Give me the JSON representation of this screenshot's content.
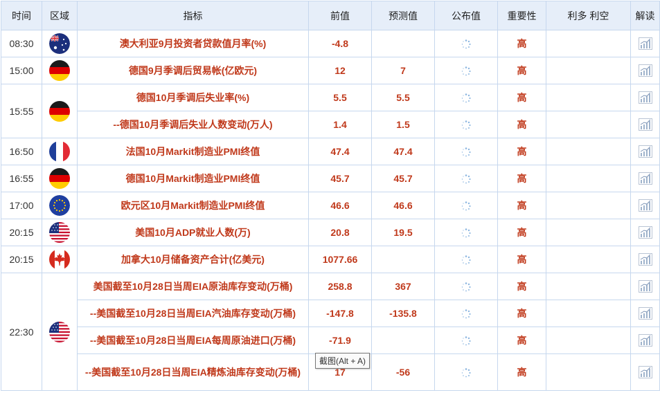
{
  "headers": {
    "time": "时间",
    "region": "区域",
    "indicator": "指标",
    "previous": "前值",
    "forecast": "预测值",
    "actual": "公布值",
    "importance": "重要性",
    "impact": "利多 利空",
    "analysis": "解读"
  },
  "rows": [
    {
      "time": "08:30",
      "flag": "australia",
      "indicator": "澳大利亚9月投资者贷款值月率(%)",
      "previous": "-4.8",
      "forecast": "",
      "importance": "高"
    },
    {
      "time": "15:00",
      "flag": "germany",
      "indicator": "德国9月季调后贸易帐(亿欧元)",
      "previous": "12",
      "forecast": "7",
      "importance": "高"
    },
    {
      "time": "15:55",
      "flag": "germany",
      "indicator": "德国10月季调后失业率(%)",
      "previous": "5.5",
      "forecast": "5.5",
      "importance": "高"
    },
    {
      "time": "",
      "flag": "",
      "indicator": "--德国10月季调后失业人数变动(万人)",
      "previous": "1.4",
      "forecast": "1.5",
      "importance": "高"
    },
    {
      "time": "16:50",
      "flag": "france",
      "indicator": "法国10月Markit制造业PMI终值",
      "previous": "47.4",
      "forecast": "47.4",
      "importance": "高"
    },
    {
      "time": "16:55",
      "flag": "germany",
      "indicator": "德国10月Markit制造业PMI终值",
      "previous": "45.7",
      "forecast": "45.7",
      "importance": "高"
    },
    {
      "time": "17:00",
      "flag": "eu",
      "indicator": "欧元区10月Markit制造业PMI终值",
      "previous": "46.6",
      "forecast": "46.6",
      "importance": "高"
    },
    {
      "time": "20:15",
      "flag": "usa",
      "indicator": "美国10月ADP就业人数(万)",
      "previous": "20.8",
      "forecast": "19.5",
      "importance": "高"
    },
    {
      "time": "20:15",
      "flag": "canada",
      "indicator": "加拿大10月储备资产合计(亿美元)",
      "previous": "1077.66",
      "forecast": "",
      "importance": "高"
    },
    {
      "time": "22:30",
      "flag": "usa",
      "indicator": "美国截至10月28日当周EIA原油库存变动(万桶)",
      "previous": "258.8",
      "forecast": "367",
      "importance": "高"
    },
    {
      "time": "",
      "flag": "",
      "indicator": "--美国截至10月28日当周EIA汽油库存变动(万桶)",
      "previous": "-147.8",
      "forecast": "-135.8",
      "importance": "高"
    },
    {
      "time": "",
      "flag": "",
      "indicator": "--美国截至10月28日当周EIA每周原油进口(万桶)",
      "previous": "-71.9",
      "forecast": "",
      "importance": "高"
    },
    {
      "time": "",
      "flag": "",
      "indicator": "--美国截至10月28日当周EIA精炼油库存变动(万桶)",
      "previous": "17",
      "forecast": "-56",
      "importance": "高"
    }
  ],
  "tooltip": "截图(Alt + A)",
  "colors": {
    "header_bg": "#e6eef9",
    "border": "#c6d7ee",
    "indicator_text": "#c0391b"
  },
  "icons": {
    "actual": "loading-spinner-icon",
    "analysis": "chart-icon"
  }
}
